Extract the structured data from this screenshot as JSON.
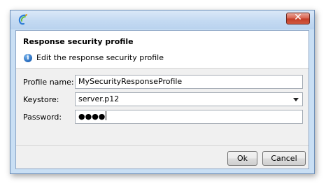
{
  "window": {
    "close_glyph": "✕"
  },
  "header": {
    "title": "Response security profile",
    "info_icon_glyph": "i",
    "description": "Edit the response security profile"
  },
  "form": {
    "profile_name": {
      "label": "Profile name:",
      "value": "MySecurityResponseProfile"
    },
    "keystore": {
      "label": "Keystore:",
      "selected": "server.p12"
    },
    "password": {
      "label": "Password:",
      "masked_value": "●●●●"
    }
  },
  "buttons": {
    "ok_label": "Ok",
    "cancel_label": "Cancel"
  },
  "colors": {
    "titlebar": "#c4daf2",
    "close_button": "#c23d28",
    "dialog_background": "#f0f0f0",
    "header_background": "#ffffff",
    "info_icon": "#2e73c3"
  }
}
